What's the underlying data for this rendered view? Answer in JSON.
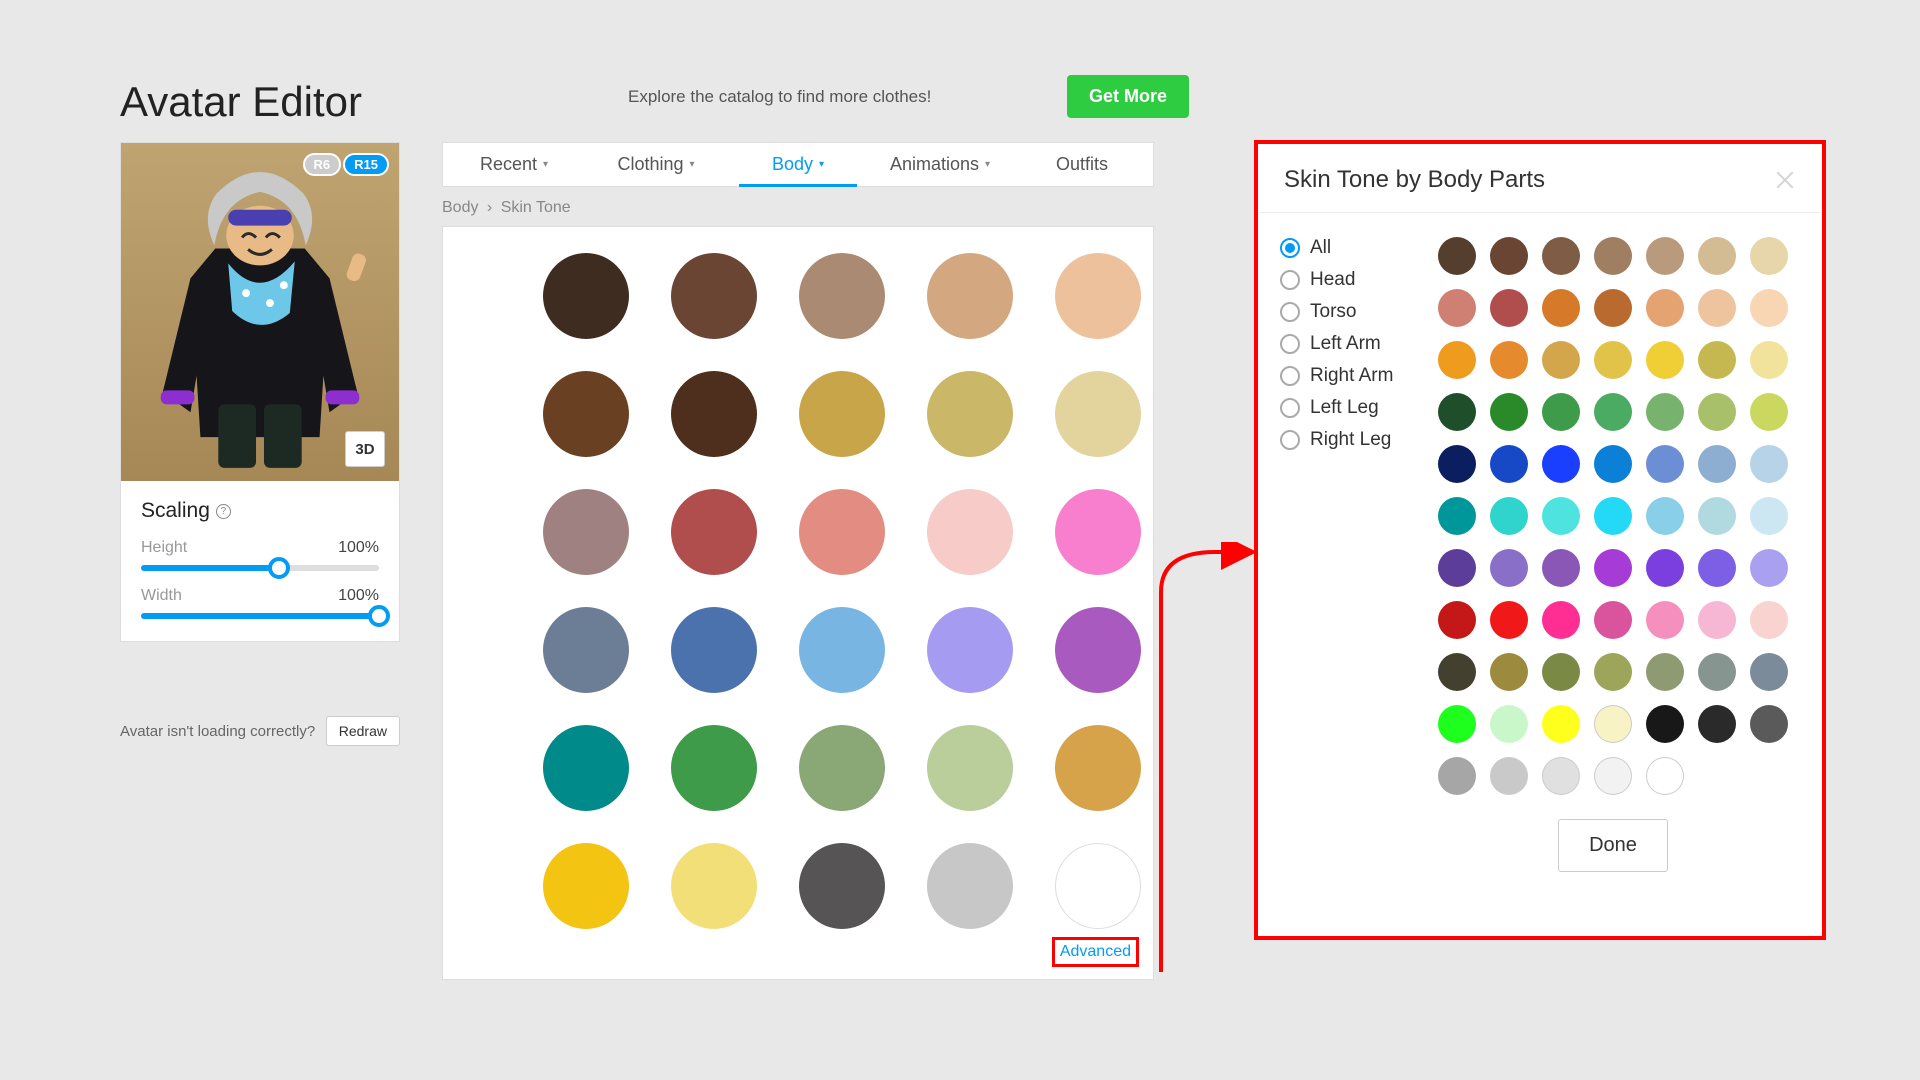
{
  "header": {
    "title": "Avatar Editor",
    "catalog_text": "Explore the catalog to find more clothes!",
    "get_more_label": "Get More"
  },
  "rig": {
    "r6_label": "R6",
    "r15_label": "R15",
    "active": "R15"
  },
  "preview": {
    "view3d_label": "3D"
  },
  "scaling": {
    "title": "Scaling",
    "height_label": "Height",
    "height_value": "100%",
    "height_percent": 58,
    "width_label": "Width",
    "width_value": "100%",
    "width_percent": 100
  },
  "loading": {
    "text": "Avatar isn't loading correctly?",
    "redraw_label": "Redraw"
  },
  "tabs": {
    "items": [
      "Recent",
      "Clothing",
      "Body",
      "Animations",
      "Outfits"
    ],
    "active_index": 2,
    "has_chevron": [
      true,
      true,
      true,
      true,
      false
    ]
  },
  "breadcrumb": {
    "items": [
      "Body",
      "Skin Tone"
    ]
  },
  "main_colors": [
    "#3f2c21",
    "#6b4534",
    "#ab8a73",
    "#d3a77f",
    "#edc19b",
    "#6a4023",
    "#4e2f1d",
    "#c9a549",
    "#cbb768",
    "#e3d39d",
    "#a08181",
    "#b04d4d",
    "#e38d82",
    "#f6cbc8",
    "#f77fce",
    "#6b7e95",
    "#4b72ac",
    "#78b5e2",
    "#a59cf2",
    "#a85abe",
    "#008a8a",
    "#3e9b49",
    "#8aa776",
    "#b9ce9a",
    "#d6a24a",
    "#f4c413",
    "#f3df78",
    "#565454",
    "#c7c7c7",
    "#ffffff"
  ],
  "advanced_label": "Advanced",
  "modal": {
    "title": "Skin Tone by Body Parts",
    "parts": [
      "All",
      "Head",
      "Torso",
      "Left Arm",
      "Right Arm",
      "Left Leg",
      "Right Leg"
    ],
    "selected_part_index": 0,
    "done_label": "Done",
    "colors": [
      "#553e2e",
      "#6b4534",
      "#7f5c44",
      "#a07e62",
      "#b99a7d",
      "#d3bb94",
      "#e6d6a9",
      "#d08072",
      "#b04d4d",
      "#d67a2a",
      "#b96a2f",
      "#e6a372",
      "#eec49f",
      "#f8d6b4",
      "#ee9b1e",
      "#e58a2d",
      "#d4a64c",
      "#e2c34a",
      "#f0cf36",
      "#c6b851",
      "#f1e39b",
      "#1f4f2a",
      "#2a8a2a",
      "#3e9b49",
      "#4cab62",
      "#78b36e",
      "#a9c06b",
      "#cad860",
      "#0a1e60",
      "#1749c7",
      "#1b3fff",
      "#0c80d6",
      "#6c8ed4",
      "#8daed1",
      "#b7d3e8",
      "#00979b",
      "#2fd4cc",
      "#4fe3e0",
      "#24d9f5",
      "#89cfe8",
      "#b1d9e0",
      "#cce7f2",
      "#5c3d99",
      "#8a6fc9",
      "#8b57b6",
      "#a63bd6",
      "#7b3fe0",
      "#7c5fe4",
      "#aaa0f0",
      "#c41818",
      "#f01818",
      "#ff2e93",
      "#d9549d",
      "#f58fbe",
      "#f6b7d4",
      "#f8d3d0",
      "#444030",
      "#9c8b3e",
      "#7a8a45",
      "#9ca55a",
      "#8e9a72",
      "#86958f",
      "#7b8b99",
      "#1eff1e",
      "#c9f7c9",
      "#ffff1e",
      "#f7f3c4",
      "#181818",
      "#2a2a2a",
      "#5a5a5a",
      "#a6a6a6",
      "#c9c9c9",
      "#e0e0e0",
      "#f2f2f2",
      "#ffffff"
    ]
  }
}
